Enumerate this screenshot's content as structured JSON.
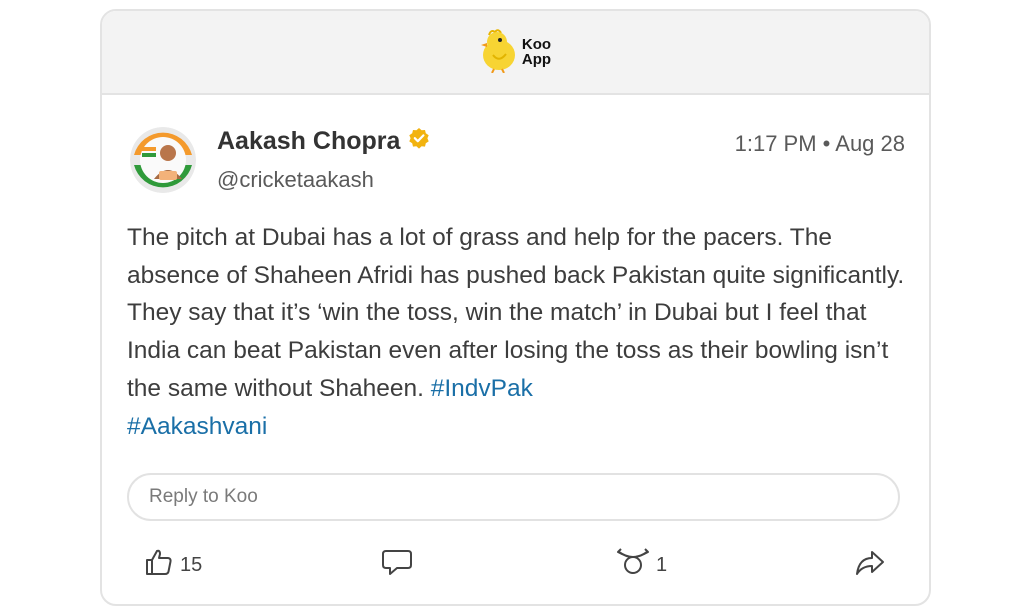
{
  "header": {
    "logo_line1": "Koo",
    "logo_line2": "App",
    "icon": "koo-chick-icon"
  },
  "post": {
    "author": {
      "name": "Aakash Chopra",
      "handle": "@cricketaakash",
      "verified": true,
      "verified_icon": "verified-badge-icon"
    },
    "timestamp": "1:17 PM • Aug 28",
    "text": "The pitch at Dubai has a lot of grass and help for the pacers. The absence of Shaheen Afridi has pushed back Pakistan quite significantly. They say that it’s ‘win the toss, win the match’ in Dubai but I feel that India can beat Pakistan even after losing the toss as their bowling isn’t the same without Shaheen.",
    "hashtags": [
      "#IndvPak",
      "#Aakashvani"
    ]
  },
  "reply": {
    "placeholder": "Reply to Koo"
  },
  "actions": {
    "like": {
      "icon": "thumbs-up-icon",
      "count": "15"
    },
    "comment": {
      "icon": "comment-icon"
    },
    "rekoo": {
      "icon": "rekoo-icon",
      "count": "1"
    },
    "share": {
      "icon": "share-icon"
    }
  },
  "colors": {
    "hashtag": "#1a6fa7",
    "verified": "#f2b30f",
    "brand_yellow": "#f7d433",
    "header_bg": "#f3f3f3"
  }
}
